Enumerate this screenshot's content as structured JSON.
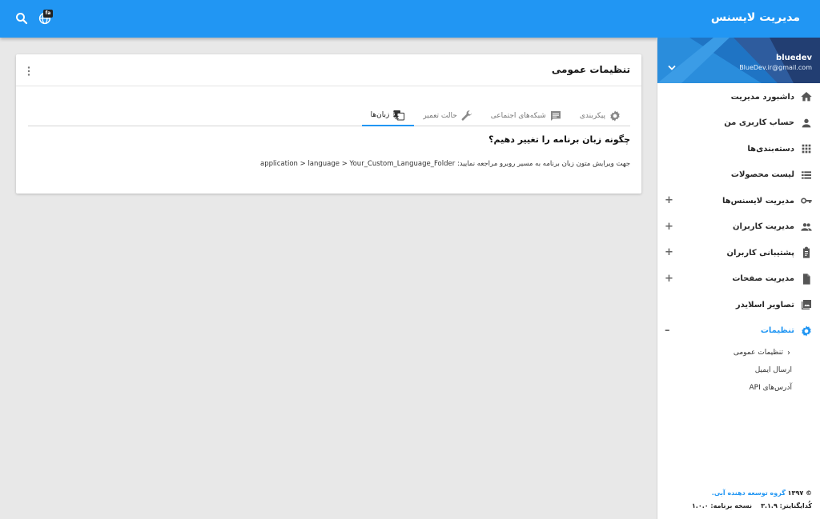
{
  "app": {
    "title": "مدیریت لایسنس"
  },
  "topbar": {
    "lang_badge": "fa"
  },
  "profile": {
    "username": "bluedev",
    "email": "BlueDev.ir@gmail.com"
  },
  "nav": {
    "items": [
      {
        "label": "داشبورد مدیریت",
        "icon": "home-icon"
      },
      {
        "label": "حساب کاربری من",
        "icon": "person-icon"
      },
      {
        "label": "دسته‌بندی‌ها",
        "icon": "grid-icon"
      },
      {
        "label": "لیست محصولات",
        "icon": "list-icon"
      },
      {
        "label": "مدیریت لایسنس‌ها",
        "icon": "key-icon",
        "expand": "+"
      },
      {
        "label": "مدیریت کاربران",
        "icon": "people-icon",
        "expand": "+"
      },
      {
        "label": "پشتیبانی کاربران",
        "icon": "clipboard-icon",
        "expand": "+"
      },
      {
        "label": "مدیریت صفحات",
        "icon": "file-icon",
        "expand": "+"
      },
      {
        "label": "تصاویر اسلایدر",
        "icon": "photo-library-icon"
      },
      {
        "label": "تنظیمات",
        "icon": "gear-icon",
        "expand": "–",
        "active": true
      }
    ],
    "sub_items": [
      {
        "label": "تنظیمات عمومی",
        "current": true
      },
      {
        "label": "ارسال ایمیل"
      },
      {
        "label": "آدرس‌های API"
      }
    ]
  },
  "footer": {
    "copyright_symbol": "©",
    "year": "۱۳۹۷",
    "brand": "گروه توسعه دهنده آبی.",
    "codeigniter": "کُدایگنایتر: ۳.۱.۹",
    "version": "نسخه برنامه: ۱.۰.۰"
  },
  "card": {
    "title": "تنظیمات عمومی",
    "tabs": [
      {
        "label": "پیکربندی",
        "icon": "gear-icon"
      },
      {
        "label": "شبکه‌های اجتماعی",
        "icon": "chat-icon"
      },
      {
        "label": "حالت تعمیر",
        "icon": "wrench-icon"
      },
      {
        "label": "زبان‌ها",
        "icon": "translate-icon",
        "active": true
      }
    ],
    "question": "چگونه زبان برنامه را تغییر دهیم؟",
    "description_prefix": "جهت ویرایش متون زبان برنامه به مسیر روبرو مراجعه نمایید:",
    "description_path": "application > language > Your_Custom_Language_Folder"
  },
  "colors": {
    "primary": "#2196f3",
    "profile_dark": "#1d3a6e",
    "background": "#e8e8e8"
  }
}
